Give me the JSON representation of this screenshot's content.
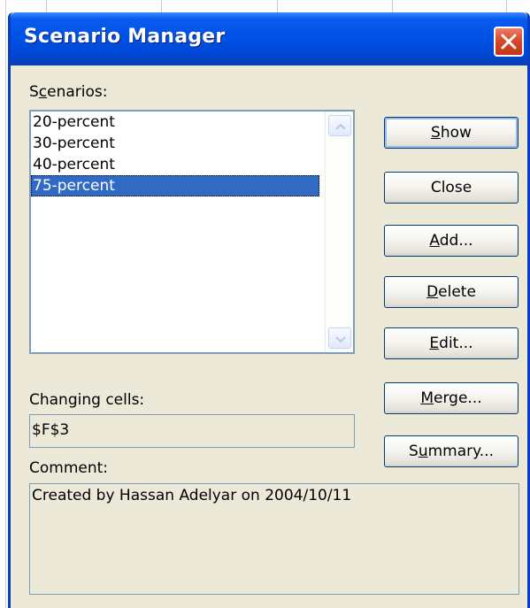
{
  "dialog": {
    "title": "Scenario Manager"
  },
  "scenarios": {
    "label_before": "S",
    "label_accel": "c",
    "label_after": "enarios:",
    "items": [
      {
        "label": "20-percent",
        "selected": false
      },
      {
        "label": "30-percent",
        "selected": false
      },
      {
        "label": "40-percent",
        "selected": false
      },
      {
        "label": "75-percent",
        "selected": true
      }
    ]
  },
  "buttons": {
    "show": {
      "accel": "S",
      "rest": "how"
    },
    "close": {
      "label": "Close"
    },
    "add": {
      "accel": "A",
      "rest": "dd..."
    },
    "delete": {
      "accel": "D",
      "rest": "elete"
    },
    "edit": {
      "accel": "E",
      "rest": "dit..."
    },
    "merge": {
      "accel": "M",
      "rest": "erge..."
    },
    "summary": {
      "before": "S",
      "accel": "u",
      "rest": "mmary..."
    }
  },
  "changing_cells": {
    "label": "Changing cells:",
    "value": "$F$3"
  },
  "comment": {
    "label": "Comment:",
    "value": "Created by Hassan Adelyar on 2004/10/11"
  },
  "colors": {
    "dialog_bg": "#ece9d8",
    "title_bar": "#0052e6",
    "selection": "#316ac5",
    "close_button": "#d7492a"
  },
  "icons": {
    "close": "close-x-icon",
    "scroll_up": "chevron-up-icon",
    "scroll_down": "chevron-down-icon"
  }
}
